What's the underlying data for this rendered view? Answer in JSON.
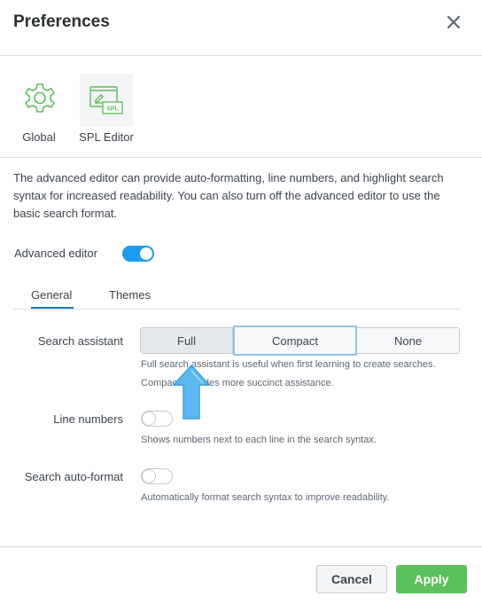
{
  "dialog": {
    "title": "Preferences",
    "close_icon": "close-icon"
  },
  "icon_tabs": [
    {
      "label": "Global",
      "icon": "gear-icon"
    },
    {
      "label": "SPL Editor",
      "icon": "spl-editor-icon",
      "icon_text": "SPL"
    }
  ],
  "description": "The advanced editor can provide auto-formatting, line numbers, and highlight search syntax for increased readability. You can also turn off the advanced editor to use the basic search format.",
  "advanced_editor": {
    "label": "Advanced editor",
    "enabled": true
  },
  "tabs": [
    {
      "label": "General",
      "selected": true
    },
    {
      "label": "Themes",
      "selected": false
    }
  ],
  "search_assistant": {
    "label": "Search assistant",
    "options": [
      "Full",
      "Compact",
      "None"
    ],
    "selected": "Full",
    "focused": "Compact",
    "help_line1": "Full search assistant is useful when first learning to create searches.",
    "help_line2": "Compact provides more succinct assistance."
  },
  "line_numbers": {
    "label": "Line numbers",
    "enabled": false,
    "help": "Shows numbers next to each line in the search syntax."
  },
  "search_auto_format": {
    "label": "Search auto-format",
    "enabled": false,
    "help": "Automatically format search syntax to improve readability."
  },
  "footer": {
    "cancel_label": "Cancel",
    "apply_label": "Apply"
  },
  "colors": {
    "accent_blue": "#1a9cf0",
    "apply_green": "#5cc05c",
    "icon_green": "#5cc05c",
    "annotation_arrow": "#5bb8f0"
  }
}
